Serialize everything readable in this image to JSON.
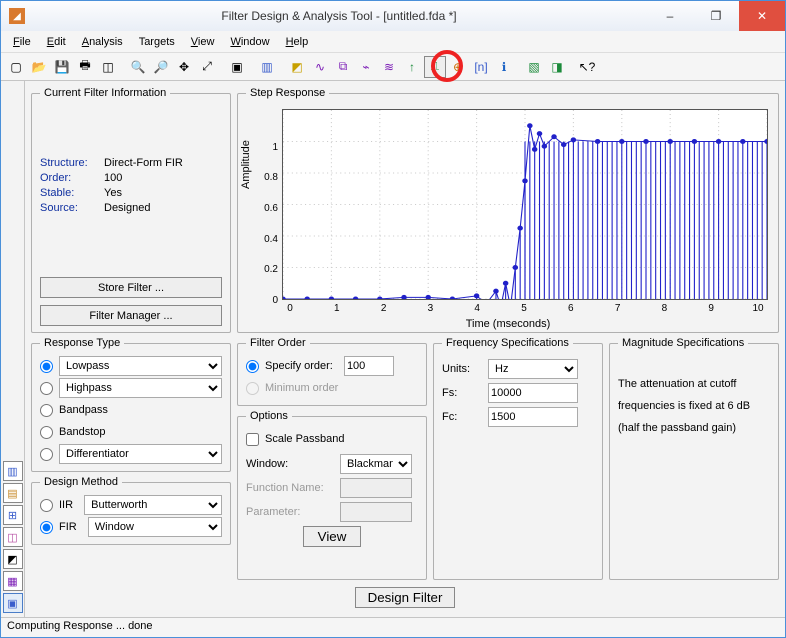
{
  "window": {
    "title": "Filter Design & Analysis Tool  -  [untitled.fda *]",
    "min": "–",
    "max": "❐",
    "close": "✕"
  },
  "menu": {
    "file": "File",
    "edit": "Edit",
    "analysis": "Analysis",
    "targets": "Targets",
    "view": "View",
    "window": "Window",
    "help": "Help"
  },
  "cfi": {
    "legend": "Current Filter Information",
    "structure_k": "Structure:",
    "structure_v": "Direct-Form FIR",
    "order_k": "Order:",
    "order_v": "100",
    "stable_k": "Stable:",
    "stable_v": "Yes",
    "source_k": "Source:",
    "source_v": "Designed",
    "store": "Store Filter ...",
    "manager": "Filter Manager ..."
  },
  "step": {
    "legend": "Step Response",
    "ylabel": "Amplitude",
    "xlabel": "Time (mseconds)"
  },
  "rt": {
    "legend": "Response Type",
    "lowpass": "Lowpass",
    "highpass": "Highpass",
    "bandpass": "Bandpass",
    "bandstop": "Bandstop",
    "diff": "Differentiator"
  },
  "dm": {
    "legend": "Design Method",
    "iir": "IIR",
    "iir_sel": "Butterworth",
    "fir": "FIR",
    "fir_sel": "Window"
  },
  "fo": {
    "legend": "Filter Order",
    "specify": "Specify order:",
    "specify_val": "100",
    "minimum": "Minimum order"
  },
  "opt": {
    "legend": "Options",
    "scale": "Scale Passband",
    "window_l": "Window:",
    "window_v": "Blackman",
    "func_l": "Function Name:",
    "param_l": "Parameter:",
    "view": "View"
  },
  "freq": {
    "legend": "Frequency Specifications",
    "units_l": "Units:",
    "units_v": "Hz",
    "fs_l": "Fs:",
    "fs_v": "10000",
    "fc_l": "Fc:",
    "fc_v": "1500"
  },
  "mag": {
    "legend": "Magnitude Specifications",
    "line1": "The attenuation at cutoff",
    "line2": "frequencies is fixed at 6 dB",
    "line3": "(half the passband gain)"
  },
  "design": "Design Filter",
  "status": "Computing Response ... done",
  "chart_data": {
    "type": "line",
    "title": "Step Response",
    "xlabel": "Time (mseconds)",
    "ylabel": "Amplitude",
    "xlim": [
      0,
      10
    ],
    "ylim": [
      0,
      1.2
    ],
    "xticks": [
      0,
      1,
      2,
      3,
      4,
      5,
      6,
      7,
      8,
      9,
      10
    ],
    "yticks": [
      0,
      0.2,
      0.4,
      0.6,
      0.8,
      1
    ],
    "x": [
      0,
      0.5,
      1,
      1.5,
      2,
      2.5,
      3,
      3.5,
      4,
      4.2,
      4.4,
      4.5,
      4.6,
      4.7,
      4.8,
      4.9,
      5.0,
      5.1,
      5.2,
      5.3,
      5.4,
      5.6,
      5.8,
      6,
      6.5,
      7,
      7.5,
      8,
      8.5,
      9,
      9.5,
      10
    ],
    "y": [
      0,
      0,
      0,
      0,
      0,
      0.01,
      0.01,
      0,
      0.02,
      -0.03,
      0.05,
      -0.05,
      0.1,
      -0.05,
      0.2,
      0.45,
      0.75,
      1.1,
      0.95,
      1.05,
      0.97,
      1.03,
      0.98,
      1.01,
      1.0,
      1.0,
      1.0,
      1.0,
      1.0,
      1.0,
      1.0,
      1.0
    ]
  }
}
